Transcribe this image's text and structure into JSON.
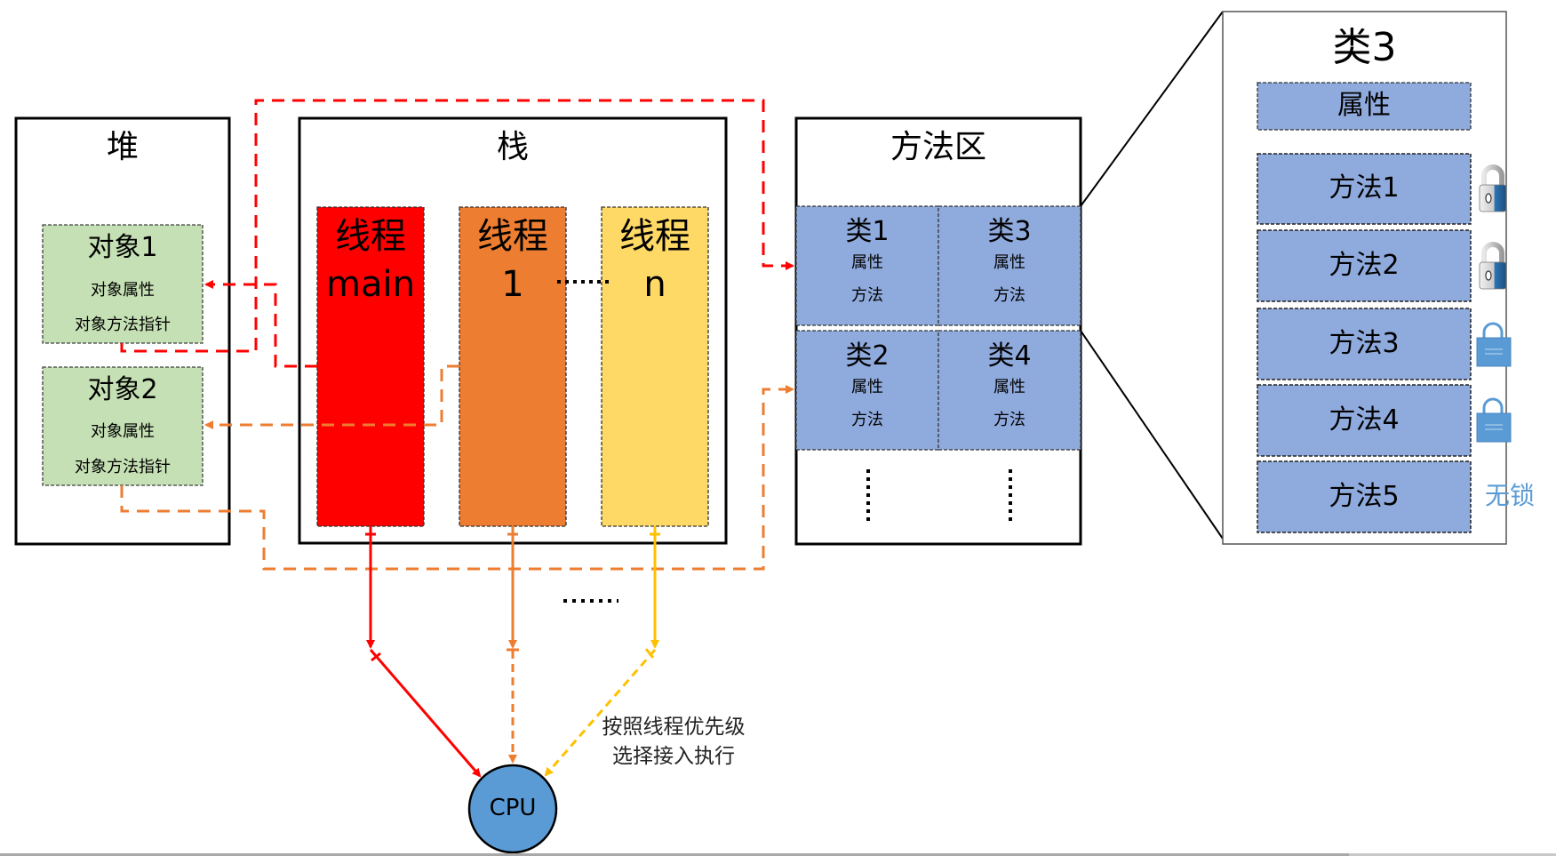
{
  "heap": {
    "title": "堆",
    "objects": [
      {
        "title": "对象1",
        "attr": "对象属性",
        "method_ptr": "对象方法指针"
      },
      {
        "title": "对象2",
        "attr": "对象属性",
        "method_ptr": "对象方法指针"
      }
    ]
  },
  "stack": {
    "title": "栈",
    "threads": [
      {
        "line1": "线程",
        "line2": "main",
        "color": "#ff0000"
      },
      {
        "line1": "线程",
        "line2": "1",
        "color": "#ed7d31"
      },
      {
        "line1": "线程",
        "line2": "n",
        "color": "#ffd966"
      }
    ],
    "between_ellipsis": "……"
  },
  "method_area": {
    "title": "方法区",
    "classes": [
      {
        "title": "类1",
        "attr": "属性",
        "method": "方法"
      },
      {
        "title": "类3",
        "attr": "属性",
        "method": "方法"
      },
      {
        "title": "类2",
        "attr": "属性",
        "method": "方法"
      },
      {
        "title": "类4",
        "attr": "属性",
        "method": "方法"
      }
    ],
    "more_vertical": "⋮"
  },
  "class_detail": {
    "title": "类3",
    "attr": "属性",
    "methods": [
      {
        "label": "方法1",
        "lock": "locked-3d"
      },
      {
        "label": "方法2",
        "lock": "locked-3d"
      },
      {
        "label": "方法3",
        "lock": "locked-flat"
      },
      {
        "label": "方法4",
        "lock": "locked-flat"
      },
      {
        "label": "方法5",
        "lock": "none"
      }
    ],
    "no_lock_label": "无锁"
  },
  "scheduler": {
    "ellipsis": "......",
    "note_line1": "按照线程优先级",
    "note_line2": "选择接入执行",
    "cpu_label": "CPU"
  },
  "colors": {
    "object_fill": "#c5e0b4",
    "class_fill": "#8faadc",
    "cpu_fill": "#5b9bd5",
    "red": "#ff0000",
    "orange": "#ed7d31",
    "yellow": "#ffc000",
    "lock_blue": "#5b9bd5"
  }
}
